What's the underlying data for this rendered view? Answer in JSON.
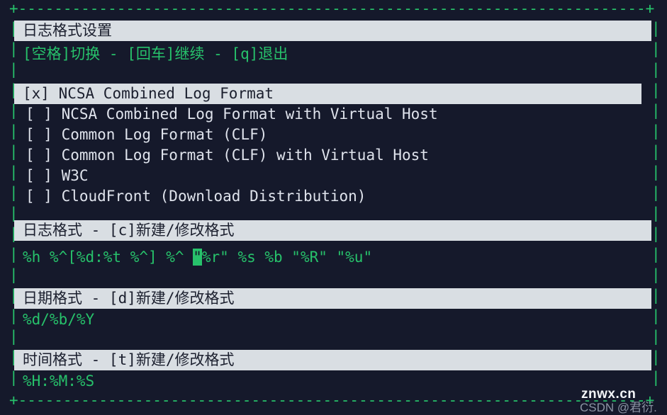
{
  "frame": {
    "top_border": "+-------------------------------------------------------------------------------------+",
    "bottom_border": "+-------------------------------------------------------------------------------------+",
    "side_border_char": "|",
    "side_rows": 18,
    "border_color": "#27c26b"
  },
  "colors": {
    "background": "#15192b",
    "accent_green": "#27c26b",
    "highlight_bg": "#d9dee3",
    "highlight_fg": "#1b1f2e",
    "text": "#dfe3ec"
  },
  "panel": {
    "title": "日志格式设置",
    "keys_hint": "[空格]切换 - [回车]继续 - [q]退出"
  },
  "format_list": {
    "items": [
      {
        "marker": "[x]",
        "label": "NCSA Combined Log Format",
        "selected": true
      },
      {
        "marker": "[ ]",
        "label": "NCSA Combined Log Format with Virtual Host",
        "selected": false
      },
      {
        "marker": "[ ]",
        "label": "Common Log Format (CLF)",
        "selected": false
      },
      {
        "marker": "[ ]",
        "label": "Common Log Format (CLF) with Virtual Host",
        "selected": false
      },
      {
        "marker": "[ ]",
        "label": "W3C",
        "selected": false
      },
      {
        "marker": "[ ]",
        "label": "CloudFront (Download Distribution)",
        "selected": false
      }
    ]
  },
  "sections": [
    {
      "id": "log_format",
      "header": "日志格式 - [c]新建/修改格式",
      "value_before_cursor": "%h %^[%d:%t %^] %^ ",
      "cursor_char": "\"",
      "value_after_cursor": "%r\" %s %b \"%R\" \"%u\""
    },
    {
      "id": "date_format",
      "header": "日期格式 - [d]新建/修改格式",
      "value": "%d/%b/%Y"
    },
    {
      "id": "time_format",
      "header": "时间格式 - [t]新建/修改格式",
      "value": "%H:%M:%S"
    }
  ],
  "watermarks": {
    "primary": "znwx.cn",
    "secondary": "CSDN @君衍."
  }
}
